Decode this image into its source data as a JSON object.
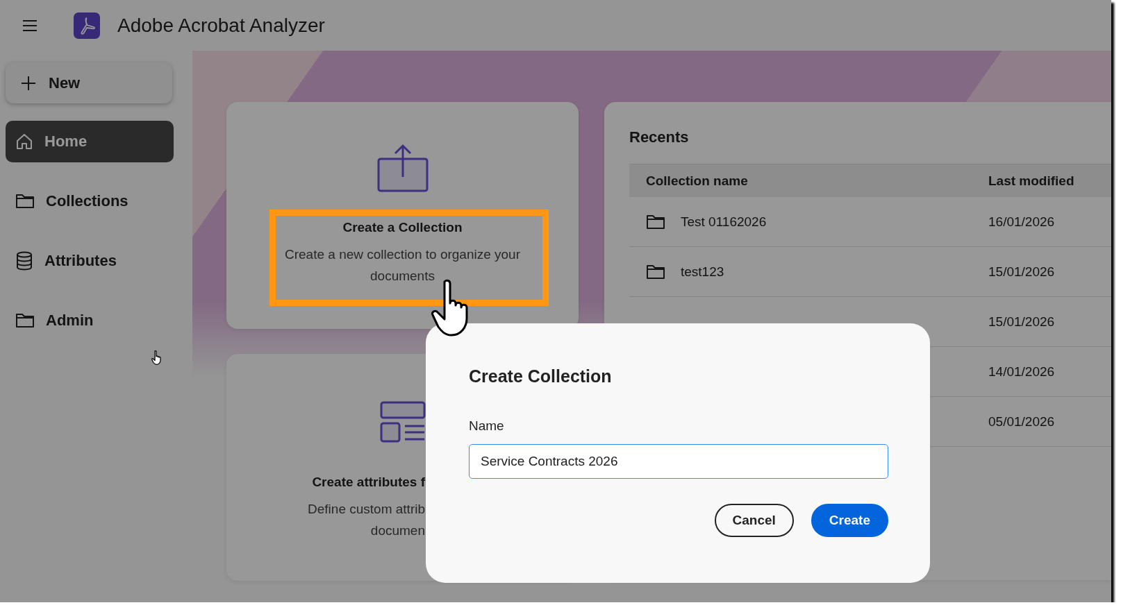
{
  "header": {
    "title": "Adobe Acrobat Analyzer"
  },
  "sidebar": {
    "new_button": "New",
    "items": [
      {
        "label": "Home",
        "selected": true
      },
      {
        "label": "Collections",
        "selected": false
      },
      {
        "label": "Attributes",
        "selected": false
      },
      {
        "label": "Admin",
        "selected": false
      }
    ]
  },
  "cards": [
    {
      "kind": "upload",
      "title": "Create a Collection",
      "description_lines": [
        "Create a new collection to organize your",
        "documents"
      ],
      "highlighted": true
    },
    {
      "kind": "attributes",
      "title": "Create attributes f",
      "description_lines": [
        "Define custom attrib",
        "documen"
      ],
      "highlighted": false
    }
  ],
  "recents": {
    "title": "Recents",
    "columns": [
      "Collection name",
      "Last modified"
    ],
    "rows": [
      {
        "name": "Test 01162026",
        "last_modified": "16/01/2026"
      },
      {
        "name": "test123",
        "last_modified": "15/01/2026"
      },
      {
        "last_modified": "15/01/2026"
      },
      {
        "last_modified": "14/01/2026"
      },
      {
        "last_modified": "05/01/2026"
      }
    ]
  },
  "dialog": {
    "title": "Create Collection",
    "field_label": "Name",
    "value": "Service Contracts 2026",
    "buttons": [
      {
        "label": "Cancel",
        "kind": "secondary"
      },
      {
        "label": "Create",
        "kind": "primary"
      }
    ]
  }
}
